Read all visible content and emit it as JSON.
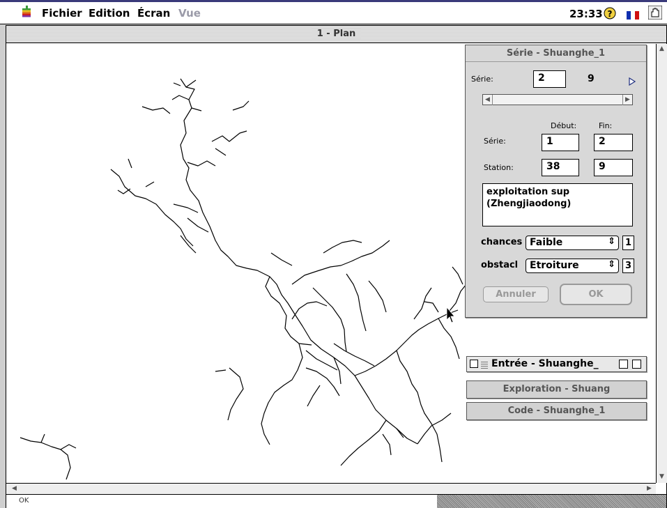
{
  "menubar": {
    "items": [
      "Fichier",
      "Edition",
      "Écran",
      "Vue"
    ],
    "clock": "23:33",
    "icons": [
      "apple-icon",
      "help-icon",
      "flag-fr-icon",
      "hand-icon"
    ]
  },
  "window": {
    "title": "1 - Plan",
    "status": "OK"
  },
  "palette": {
    "title": "Série - Shuanghe_1",
    "serie_label": "Série:",
    "serie_value": "2",
    "serie_count": "9",
    "debut_label": "Début:",
    "fin_label": "Fin:",
    "row_serie_label": "Série:",
    "row_serie_debut": "1",
    "row_serie_fin": "2",
    "row_station_label": "Station:",
    "row_station_debut": "38",
    "row_station_fin": "9",
    "comment": "exploitation sup (Zhengjiaodong)",
    "chances_label": "chances",
    "chances_value": "Faible",
    "chances_num": "1",
    "obstacle_label": "obstacl",
    "obstacle_value": "Etroiture",
    "obstacle_num": "3",
    "cancel": "Annuler",
    "ok": "OK"
  },
  "floating": {
    "entree": "Entrée - Shuanghe_",
    "exploration": "Exploration - Shuang",
    "code": "Code - Shuanghe_1"
  }
}
